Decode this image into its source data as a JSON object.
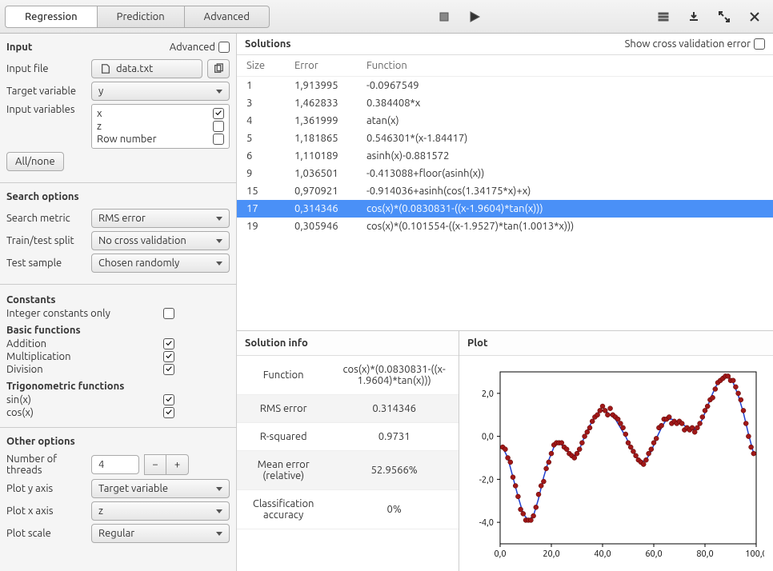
{
  "toolbar": {
    "tabs": [
      "Regression",
      "Prediction",
      "Advanced"
    ],
    "active_tab": 0
  },
  "input_section": {
    "title": "Input",
    "advanced_label": "Advanced",
    "file_label": "Input file",
    "file_value": "data.txt",
    "target_label": "Target variable",
    "target_value": "y",
    "vars_label": "Input variables",
    "all_none": "All/none",
    "var_list": [
      {
        "name": "x",
        "checked": true
      },
      {
        "name": "z",
        "checked": false
      },
      {
        "name": "Row number",
        "checked": false
      }
    ]
  },
  "search_section": {
    "title": "Search options",
    "metric_label": "Search metric",
    "metric_value": "RMS error",
    "split_label": "Train/test split",
    "split_value": "No cross validation",
    "sample_label": "Test sample",
    "sample_value": "Chosen randomly",
    "constants_head": "Constants",
    "int_const_label": "Integer constants only",
    "int_const_checked": false,
    "basic_head": "Basic functions",
    "basic_funcs": [
      {
        "name": "Addition",
        "checked": true
      },
      {
        "name": "Multiplication",
        "checked": true
      },
      {
        "name": "Division",
        "checked": true
      }
    ],
    "trig_head": "Trigonometric functions",
    "trig_funcs": [
      {
        "name": "sin(x)",
        "checked": true
      },
      {
        "name": "cos(x)",
        "checked": true
      }
    ]
  },
  "other_section": {
    "title": "Other options",
    "threads_label": "Number of threads",
    "threads_value": "4",
    "y_axis_label": "Plot y axis",
    "y_axis_value": "Target variable",
    "x_axis_label": "Plot x axis",
    "x_axis_value": "z",
    "scale_label": "Plot scale",
    "scale_value": "Regular"
  },
  "solutions": {
    "title": "Solutions",
    "show_cv_label": "Show cross validation error",
    "headers": [
      "Size",
      "Error",
      "Function"
    ],
    "rows": [
      {
        "size": "1",
        "error": "1,913995",
        "func": "-0.0967549"
      },
      {
        "size": "3",
        "error": "1,462833",
        "func": "0.384408*x"
      },
      {
        "size": "4",
        "error": "1,361999",
        "func": "atan(x)"
      },
      {
        "size": "5",
        "error": "1,181865",
        "func": "0.546301*(x-1.84417)"
      },
      {
        "size": "6",
        "error": "1,110189",
        "func": "asinh(x)-0.881572"
      },
      {
        "size": "9",
        "error": "1,036501",
        "func": "-0.413088+floor(asinh(x))"
      },
      {
        "size": "15",
        "error": "0,970921",
        "func": "-0.914036+asinh(cos(1.34175*x)+x)"
      },
      {
        "size": "17",
        "error": "0,314346",
        "func": "cos(x)*(0.0830831-((x-1.9604)*tan(x)))"
      },
      {
        "size": "19",
        "error": "0,305946",
        "func": "cos(x)*(0.101554-((x-1.9527)*tan(1.0013*x)))"
      }
    ],
    "selected_index": 7
  },
  "solution_info": {
    "title": "Solution info",
    "rows": [
      {
        "label": "Function",
        "value": "cos(x)*(0.0830831-((x-1.9604)*tan(x)))"
      },
      {
        "label": "RMS error",
        "value": "0.314346"
      },
      {
        "label": "R-squared",
        "value": "0.9731"
      },
      {
        "label": "Mean error (relative)",
        "value": "52.9566%"
      },
      {
        "label": "Classification accuracy",
        "value": "0%"
      }
    ]
  },
  "plot": {
    "title": "Plot"
  },
  "chart_data": {
    "type": "scatter-with-line",
    "xlabel": "",
    "ylabel": "",
    "xlim": [
      0,
      100
    ],
    "ylim": [
      -5,
      3
    ],
    "xticks": [
      "0,0",
      "20,0",
      "40,0",
      "60,0",
      "80,0",
      "100,0"
    ],
    "yticks": [
      "-4,0",
      "-2,0",
      "0,0",
      "2,0"
    ],
    "series": [
      {
        "name": "data",
        "type": "scatter",
        "color": "#a01818",
        "points": [
          [
            1,
            -0.5
          ],
          [
            2,
            -0.6
          ],
          [
            3,
            -1.0
          ],
          [
            4,
            -1.2
          ],
          [
            5,
            -1.9
          ],
          [
            6,
            -2.3
          ],
          [
            7,
            -2.8
          ],
          [
            8,
            -3.4
          ],
          [
            9,
            -3.6
          ],
          [
            10,
            -3.9
          ],
          [
            11,
            -3.9
          ],
          [
            12,
            -3.9
          ],
          [
            13,
            -3.7
          ],
          [
            14,
            -3.3
          ],
          [
            15,
            -2.7
          ],
          [
            16,
            -2.3
          ],
          [
            17,
            -2.1
          ],
          [
            18,
            -1.5
          ],
          [
            19,
            -1.2
          ],
          [
            20,
            -0.8
          ],
          [
            21,
            -0.4
          ],
          [
            22,
            -0.3
          ],
          [
            23,
            -0.3
          ],
          [
            24,
            -0.3
          ],
          [
            25,
            -0.5
          ],
          [
            26,
            -0.6
          ],
          [
            27,
            -0.8
          ],
          [
            28,
            -0.9
          ],
          [
            29,
            -1.0
          ],
          [
            30,
            -0.8
          ],
          [
            31,
            -0.6
          ],
          [
            32,
            -0.3
          ],
          [
            33,
            0.0
          ],
          [
            34,
            0.2
          ],
          [
            35,
            0.4
          ],
          [
            36,
            0.7
          ],
          [
            37,
            0.9
          ],
          [
            38,
            1.0
          ],
          [
            39,
            1.2
          ],
          [
            40,
            1.4
          ],
          [
            41,
            1.2
          ],
          [
            42,
            1.0
          ],
          [
            43,
            1.3
          ],
          [
            44,
            1.0
          ],
          [
            45,
            0.9
          ],
          [
            46,
            0.8
          ],
          [
            47,
            0.6
          ],
          [
            48,
            0.4
          ],
          [
            49,
            0.1
          ],
          [
            50,
            -0.3
          ],
          [
            51,
            -0.5
          ],
          [
            52,
            -0.7
          ],
          [
            53,
            -0.9
          ],
          [
            54,
            -1.1
          ],
          [
            55,
            -1.2
          ],
          [
            56,
            -1.3
          ],
          [
            57,
            -1.1
          ],
          [
            58,
            -0.8
          ],
          [
            59,
            -0.6
          ],
          [
            60,
            -0.3
          ],
          [
            61,
            -0.1
          ],
          [
            62,
            0.4
          ],
          [
            63,
            0.5
          ],
          [
            64,
            0.8
          ],
          [
            65,
            0.8
          ],
          [
            66,
            0.9
          ],
          [
            67,
            0.6
          ],
          [
            68,
            0.7
          ],
          [
            69,
            0.6
          ],
          [
            70,
            0.7
          ],
          [
            71,
            0.6
          ],
          [
            72,
            0.3
          ],
          [
            73,
            0.4
          ],
          [
            74,
            0.3
          ],
          [
            75,
            0.4
          ],
          [
            76,
            0.2
          ],
          [
            77,
            0.4
          ],
          [
            78,
            0.6
          ],
          [
            79,
            0.9
          ],
          [
            80,
            1.2
          ],
          [
            81,
            1.4
          ],
          [
            82,
            1.7
          ],
          [
            83,
            1.8
          ],
          [
            84,
            2.2
          ],
          [
            85,
            2.5
          ],
          [
            86,
            2.6
          ],
          [
            87,
            2.7
          ],
          [
            88,
            2.8
          ],
          [
            89,
            2.8
          ],
          [
            90,
            2.6
          ],
          [
            91,
            2.6
          ],
          [
            92,
            2.3
          ],
          [
            93,
            2.0
          ],
          [
            94,
            1.7
          ],
          [
            95,
            1.2
          ],
          [
            96,
            0.6
          ],
          [
            97,
            0.0
          ],
          [
            98,
            -0.5
          ],
          [
            99,
            -0.8
          ]
        ]
      },
      {
        "name": "fit",
        "type": "line",
        "color": "#2040d0",
        "points": [
          [
            1,
            -0.5
          ],
          [
            3,
            -1.0
          ],
          [
            5,
            -1.9
          ],
          [
            7,
            -2.8
          ],
          [
            9,
            -3.6
          ],
          [
            11,
            -3.9
          ],
          [
            13,
            -3.7
          ],
          [
            15,
            -2.9
          ],
          [
            17,
            -1.9
          ],
          [
            19,
            -1.1
          ],
          [
            21,
            -0.5
          ],
          [
            23,
            -0.3
          ],
          [
            25,
            -0.5
          ],
          [
            27,
            -0.8
          ],
          [
            29,
            -0.9
          ],
          [
            31,
            -0.6
          ],
          [
            33,
            0.0
          ],
          [
            35,
            0.5
          ],
          [
            37,
            0.9
          ],
          [
            39,
            1.2
          ],
          [
            41,
            1.2
          ],
          [
            43,
            1.0
          ],
          [
            45,
            0.8
          ],
          [
            47,
            0.4
          ],
          [
            49,
            0.0
          ],
          [
            51,
            -0.5
          ],
          [
            53,
            -0.9
          ],
          [
            55,
            -1.2
          ],
          [
            57,
            -1.1
          ],
          [
            59,
            -0.7
          ],
          [
            61,
            -0.1
          ],
          [
            63,
            0.4
          ],
          [
            65,
            0.8
          ],
          [
            67,
            0.8
          ],
          [
            69,
            0.7
          ],
          [
            71,
            0.6
          ],
          [
            73,
            0.4
          ],
          [
            75,
            0.3
          ],
          [
            77,
            0.4
          ],
          [
            79,
            0.8
          ],
          [
            81,
            1.4
          ],
          [
            83,
            2.0
          ],
          [
            85,
            2.5
          ],
          [
            87,
            2.8
          ],
          [
            89,
            2.8
          ],
          [
            91,
            2.5
          ],
          [
            93,
            1.9
          ],
          [
            95,
            1.1
          ],
          [
            97,
            0.1
          ],
          [
            99,
            -0.8
          ]
        ]
      }
    ]
  }
}
